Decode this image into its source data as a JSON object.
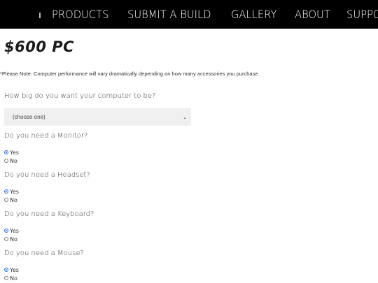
{
  "nav": {
    "items": [
      "PRODUCTS",
      "SUBMIT A BUILD",
      "GALLERY",
      "ABOUT",
      "SUPPORT"
    ]
  },
  "page": {
    "title": "$600 PC",
    "note": "*Please Note: Computer performance will vary dramatically depending on how many accessories you purchase."
  },
  "form": {
    "size_question": "How big do you want your computer to be?",
    "size_select_value": "(choose one)",
    "questions": [
      {
        "label": "Do you need a Monitor?",
        "yes": "Yes",
        "no": "No",
        "selected": "Yes"
      },
      {
        "label": "Do you need a Headset?",
        "yes": "Yes",
        "no": "No",
        "selected": "Yes"
      },
      {
        "label": "Do you need a Keyboard?",
        "yes": "Yes",
        "no": "No",
        "selected": "Yes"
      },
      {
        "label": "Do you need a Mouse?",
        "yes": "Yes",
        "no": "No",
        "selected": "Yes"
      }
    ]
  },
  "colors": {
    "nav_bg": "#000000",
    "radio_accent": "#1a73e8",
    "select_bg": "#f0f0f0"
  }
}
